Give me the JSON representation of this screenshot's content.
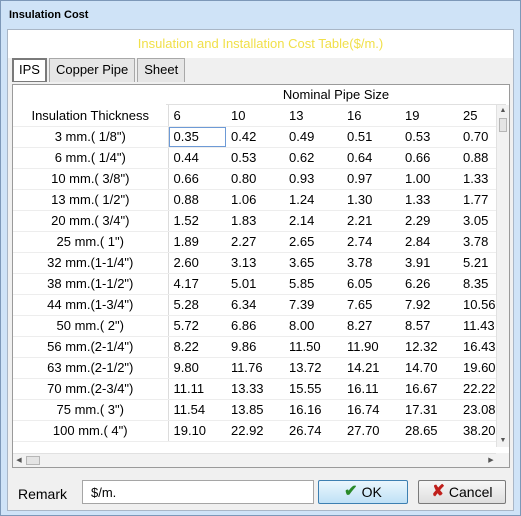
{
  "window": {
    "title": "Insulation Cost"
  },
  "banner": {
    "title": "Insulation and Installation Cost Table($/m.)",
    "color": "#f1e04a"
  },
  "tabs": [
    {
      "label": "IPS",
      "active": true
    },
    {
      "label": "Copper Pipe",
      "active": false
    },
    {
      "label": "Sheet",
      "active": false
    }
  ],
  "grid": {
    "group_header": "Nominal Pipe Size",
    "row_header_title": "Insulation Thickness",
    "columns": [
      "6",
      "10",
      "13",
      "16",
      "19",
      "25"
    ],
    "rows": [
      {
        "label": "3 mm.( 1/8\")",
        "values": [
          "0.35",
          "0.42",
          "0.49",
          "0.51",
          "0.53",
          "0.70"
        ]
      },
      {
        "label": "6 mm.( 1/4\")",
        "values": [
          "0.44",
          "0.53",
          "0.62",
          "0.64",
          "0.66",
          "0.88"
        ]
      },
      {
        "label": "10 mm.( 3/8\")",
        "values": [
          "0.66",
          "0.80",
          "0.93",
          "0.97",
          "1.00",
          "1.33"
        ]
      },
      {
        "label": "13 mm.( 1/2\")",
        "values": [
          "0.88",
          "1.06",
          "1.24",
          "1.30",
          "1.33",
          "1.77"
        ]
      },
      {
        "label": "20 mm.( 3/4\")",
        "values": [
          "1.52",
          "1.83",
          "2.14",
          "2.21",
          "2.29",
          "3.05"
        ]
      },
      {
        "label": "25 mm.(    1\")",
        "values": [
          "1.89",
          "2.27",
          "2.65",
          "2.74",
          "2.84",
          "3.78"
        ]
      },
      {
        "label": "32 mm.(1-1/4\")",
        "values": [
          "2.60",
          "3.13",
          "3.65",
          "3.78",
          "3.91",
          "5.21"
        ]
      },
      {
        "label": "38 mm.(1-1/2\")",
        "values": [
          "4.17",
          "5.01",
          "5.85",
          "6.05",
          "6.26",
          "8.35"
        ]
      },
      {
        "label": "44 mm.(1-3/4\")",
        "values": [
          "5.28",
          "6.34",
          "7.39",
          "7.65",
          "7.92",
          "10.56"
        ]
      },
      {
        "label": "50 mm.(    2\")",
        "values": [
          "5.72",
          "6.86",
          "8.00",
          "8.27",
          "8.57",
          "11.43"
        ]
      },
      {
        "label": "56 mm.(2-1/4\")",
        "values": [
          "8.22",
          "9.86",
          "11.50",
          "11.90",
          "12.32",
          "16.43"
        ]
      },
      {
        "label": "63 mm.(2-1/2\")",
        "values": [
          "9.80",
          "11.76",
          "13.72",
          "14.21",
          "14.70",
          "19.60"
        ]
      },
      {
        "label": "70 mm.(2-3/4\")",
        "values": [
          "11.11",
          "13.33",
          "15.55",
          "16.11",
          "16.67",
          "22.22"
        ]
      },
      {
        "label": "75 mm.(    3\")",
        "values": [
          "11.54",
          "13.85",
          "16.16",
          "16.74",
          "17.31",
          "23.08"
        ]
      },
      {
        "label": "100 mm.(    4\")",
        "values": [
          "19.10",
          "22.92",
          "26.74",
          "27.70",
          "28.65",
          "38.20"
        ]
      }
    ]
  },
  "footer": {
    "remark_label": "Remark",
    "remark_value": "$/m.",
    "ok_label": "OK",
    "cancel_label": "Cancel",
    "ok_icon": "checkmark-icon",
    "cancel_icon": "x-icon"
  }
}
